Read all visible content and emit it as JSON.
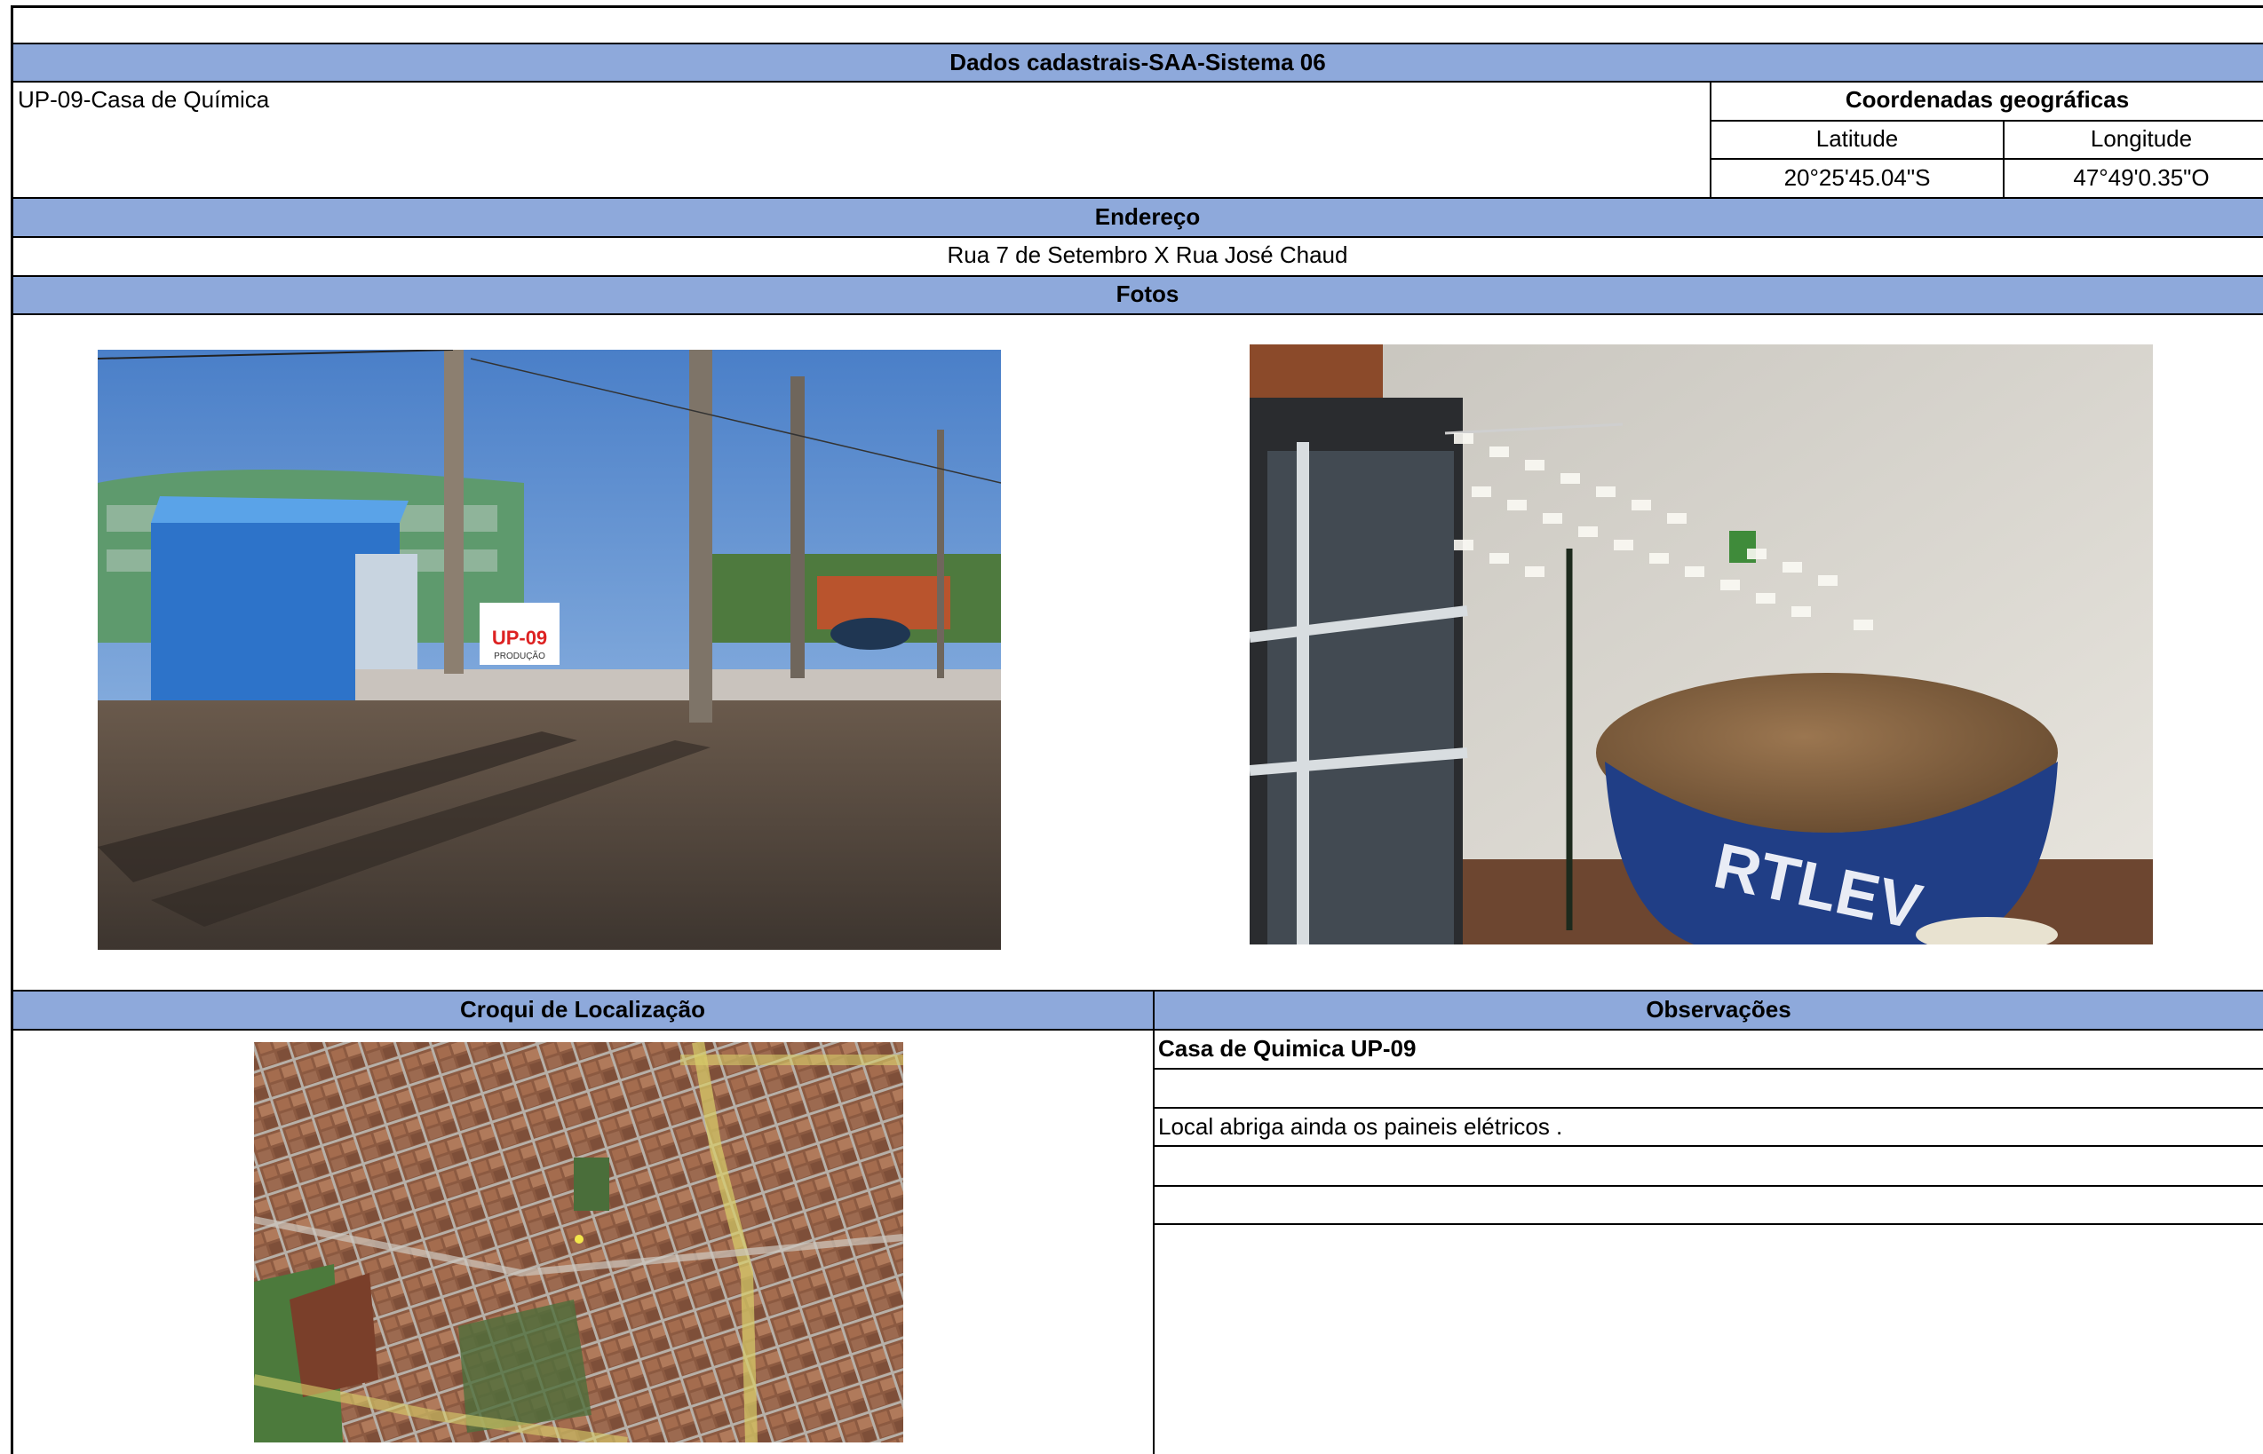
{
  "header": {
    "title": "Dados cadastrais-SAA-Sistema 06"
  },
  "unit": {
    "name": "UP-09-Casa de Química"
  },
  "coordinates": {
    "heading": "Coordenadas geográficas",
    "lat_label": "Latitude",
    "lon_label": "Longitude",
    "lat_value": "20°25'45.04\"S",
    "lon_value": "47°49'0.35\"O"
  },
  "address": {
    "heading": "Endereço",
    "value": "Rua 7 de Setembro X Rua José Chaud"
  },
  "photos": {
    "heading": "Fotos",
    "sign_text": "UP-09",
    "sign_sub": "PRODUÇÃO",
    "tank_brand": "RTLEV"
  },
  "location": {
    "heading": "Croqui de Localização"
  },
  "observations": {
    "heading": "Observações",
    "lines": [
      "Casa de Quimica UP-09",
      "",
      "Local abriga ainda os paineis elétricos  .",
      "",
      ""
    ]
  }
}
